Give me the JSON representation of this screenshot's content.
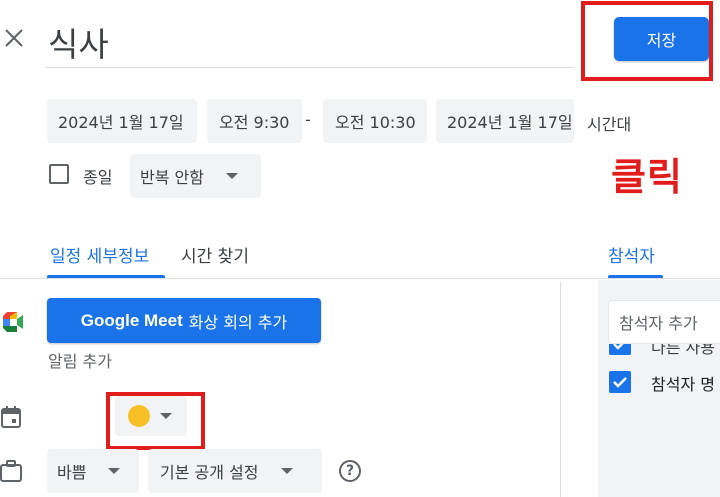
{
  "header": {
    "title_value": "식사",
    "save_label": "저장"
  },
  "datetime": {
    "start_date": "2024년 1월 17일",
    "start_time": "오전 9:30",
    "separator": "-",
    "end_time": "오전 10:30",
    "end_date": "2024년 1월 17일",
    "timezone_label": "시간대"
  },
  "options": {
    "allday_label": "종일",
    "repeat_value": "반복 안함"
  },
  "annotation": {
    "click_label": "클릭"
  },
  "tabs": [
    {
      "label": "일정 세부정보"
    },
    {
      "label": "시간 찾기"
    }
  ],
  "guests": {
    "tab_label": "참석자",
    "add_placeholder": "참석자 추가"
  },
  "details": {
    "meet_brand": "Google Meet",
    "meet_suffix": "화상 회의 추가",
    "add_notification": "알림 추가",
    "event_color": "#f6bf26",
    "busy_value": "바쁨",
    "visibility_value": "기본 공개 설정",
    "help_symbol": "?"
  },
  "guest_list": [
    {
      "label": "다른 사용"
    },
    {
      "label": "참석자 명"
    }
  ],
  "icons": [
    "close-icon",
    "google-meet-icon",
    "calendar-icon",
    "briefcase-icon",
    "help-icon",
    "chevron-down-icon",
    "check-icon"
  ],
  "colors": {
    "accent": "#1a73e8",
    "annotation_red": "#e21b1b"
  }
}
